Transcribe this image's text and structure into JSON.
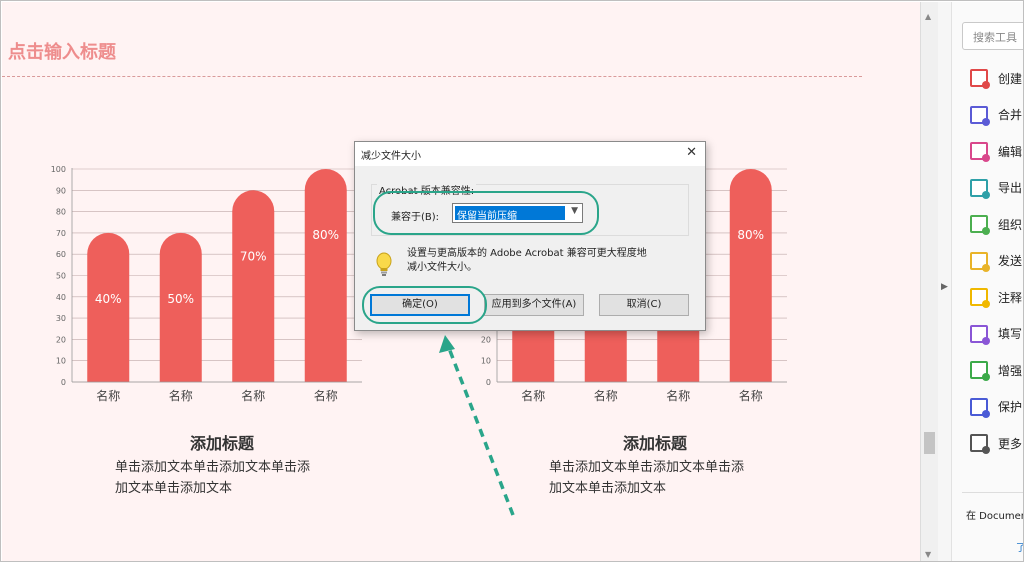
{
  "slide": {
    "title": "点击输入标题",
    "background": "#fff3f3",
    "accent": "#ee5f5b",
    "left_block": {
      "heading": "添加标题",
      "body_lines": [
        "单击添加文本单击添加文本单击添",
        "加文本单击添加文本"
      ]
    },
    "right_block": {
      "heading": "添加标题",
      "body_lines": [
        "单击添加文本单击添加文本单击添",
        "加文本单击添加文本"
      ]
    }
  },
  "chart_data": [
    {
      "type": "bar",
      "categories": [
        "名称",
        "名称",
        "名称",
        "名称"
      ],
      "values": [
        70,
        70,
        90,
        100
      ],
      "data_labels": [
        "40%",
        "50%",
        "70%",
        "80%"
      ],
      "ylim": [
        0,
        100
      ],
      "yticks": [
        0,
        10,
        20,
        30,
        40,
        50,
        60,
        70,
        80,
        90,
        100
      ],
      "grid": true,
      "color": "#ee5f5b"
    },
    {
      "type": "bar",
      "categories": [
        "名称",
        "名称",
        "名称",
        "名称"
      ],
      "values": [
        70,
        70,
        90,
        100
      ],
      "data_labels": [
        "",
        "",
        "",
        "80%"
      ],
      "ylim": [
        0,
        100
      ],
      "yticks": [
        0,
        10,
        20,
        30,
        40,
        50,
        60,
        70,
        80,
        90,
        100
      ],
      "grid": true,
      "color": "#ee5f5b"
    }
  ],
  "dialog": {
    "title": "减少文件大小",
    "group_label": "Acrobat 版本兼容性:",
    "compat_label": "兼容于(B):",
    "compat_value": "保留当前压缩",
    "message": "设置与更高版本的 Adobe Acrobat 兼容可更大程度地减小文件大小。",
    "ok_label": "确定(O)",
    "apply_label": "应用到多个文件(A)",
    "cancel_label": "取消(C)",
    "close_glyph": "✕"
  },
  "tools_panel": {
    "search_placeholder": "搜索工具",
    "items": [
      {
        "label": "创建",
        "icon": "create-pdf-icon",
        "color": "#e04848"
      },
      {
        "label": "合并",
        "icon": "combine-files-icon",
        "color": "#5b5bd6"
      },
      {
        "label": "编辑",
        "icon": "edit-pdf-icon",
        "color": "#d9488c"
      },
      {
        "label": "导出",
        "icon": "export-pdf-icon",
        "color": "#2ea0a8"
      },
      {
        "label": "组织",
        "icon": "organize-pages-icon",
        "color": "#4caf50"
      },
      {
        "label": "发送",
        "icon": "send-for-signature-icon",
        "color": "#e9b42a"
      },
      {
        "label": "注释",
        "icon": "comment-icon",
        "color": "#f0b800"
      },
      {
        "label": "填写",
        "icon": "fill-sign-icon",
        "color": "#8a56d6"
      },
      {
        "label": "增强",
        "icon": "enhance-scans-icon",
        "color": "#3caa4a"
      },
      {
        "label": "保护",
        "icon": "protect-icon",
        "color": "#4a5bd6"
      },
      {
        "label": "更多",
        "icon": "more-tools-icon",
        "color": "#555555"
      }
    ],
    "footer_text": "在 Document",
    "footer_link": "了"
  },
  "annotation_color": "#2aa58a"
}
